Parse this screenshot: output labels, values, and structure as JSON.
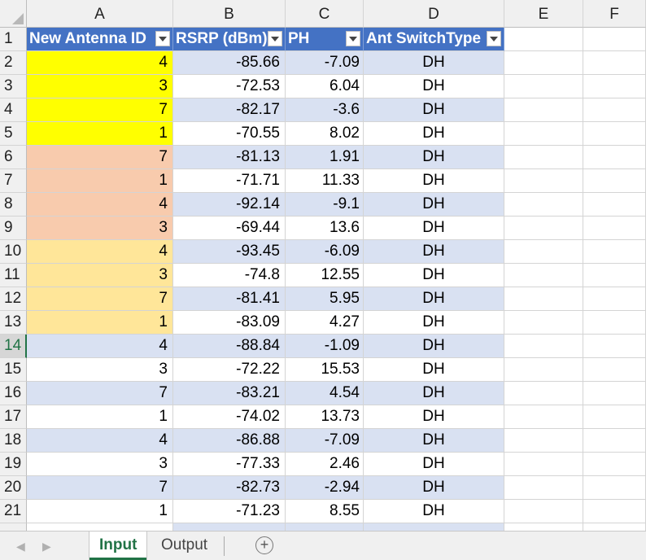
{
  "column_headers": [
    "A",
    "B",
    "C",
    "D",
    "E",
    "F"
  ],
  "table": {
    "headers": [
      "New Antenna ID",
      "RSRP (dBm)",
      "PH",
      "Ant SwitchType"
    ],
    "rows": [
      {
        "num": "2",
        "a": "4",
        "b": "-85.66",
        "c": "-7.09",
        "d": "DH",
        "fill": "#ffff00"
      },
      {
        "num": "3",
        "a": "3",
        "b": "-72.53",
        "c": "6.04",
        "d": "DH",
        "fill": "#ffff00"
      },
      {
        "num": "4",
        "a": "7",
        "b": "-82.17",
        "c": "-3.6",
        "d": "DH",
        "fill": "#ffff00"
      },
      {
        "num": "5",
        "a": "1",
        "b": "-70.55",
        "c": "8.02",
        "d": "DH",
        "fill": "#ffff00"
      },
      {
        "num": "6",
        "a": "7",
        "b": "-81.13",
        "c": "1.91",
        "d": "DH",
        "fill": "#f8cbad"
      },
      {
        "num": "7",
        "a": "1",
        "b": "-71.71",
        "c": "11.33",
        "d": "DH",
        "fill": "#f8cbad"
      },
      {
        "num": "8",
        "a": "4",
        "b": "-92.14",
        "c": "-9.1",
        "d": "DH",
        "fill": "#f8cbad"
      },
      {
        "num": "9",
        "a": "3",
        "b": "-69.44",
        "c": "13.6",
        "d": "DH",
        "fill": "#f8cbad"
      },
      {
        "num": "10",
        "a": "4",
        "b": "-93.45",
        "c": "-6.09",
        "d": "DH",
        "fill": "#ffe699"
      },
      {
        "num": "11",
        "a": "3",
        "b": "-74.8",
        "c": "12.55",
        "d": "DH",
        "fill": "#ffe699"
      },
      {
        "num": "12",
        "a": "7",
        "b": "-81.41",
        "c": "5.95",
        "d": "DH",
        "fill": "#ffe699"
      },
      {
        "num": "13",
        "a": "1",
        "b": "-83.09",
        "c": "4.27",
        "d": "DH",
        "fill": "#ffe699"
      },
      {
        "num": "14",
        "a": "4",
        "b": "-88.84",
        "c": "-1.09",
        "d": "DH",
        "fill": ""
      },
      {
        "num": "15",
        "a": "3",
        "b": "-72.22",
        "c": "15.53",
        "d": "DH",
        "fill": ""
      },
      {
        "num": "16",
        "a": "7",
        "b": "-83.21",
        "c": "4.54",
        "d": "DH",
        "fill": ""
      },
      {
        "num": "17",
        "a": "1",
        "b": "-74.02",
        "c": "13.73",
        "d": "DH",
        "fill": ""
      },
      {
        "num": "18",
        "a": "4",
        "b": "-86.88",
        "c": "-7.09",
        "d": "DH",
        "fill": ""
      },
      {
        "num": "19",
        "a": "3",
        "b": "-77.33",
        "c": "2.46",
        "d": "DH",
        "fill": ""
      },
      {
        "num": "20",
        "a": "7",
        "b": "-82.73",
        "c": "-2.94",
        "d": "DH",
        "fill": ""
      },
      {
        "num": "21",
        "a": "1",
        "b": "-71.23",
        "c": "8.55",
        "d": "DH",
        "fill": ""
      }
    ]
  },
  "selected_row": "14",
  "sheet_tabs": [
    "Input",
    "Output"
  ],
  "active_tab": "Input",
  "colors": {
    "header_blue": "#4472c4",
    "band_blue": "#d9e1f2",
    "accent_green": "#217346"
  }
}
